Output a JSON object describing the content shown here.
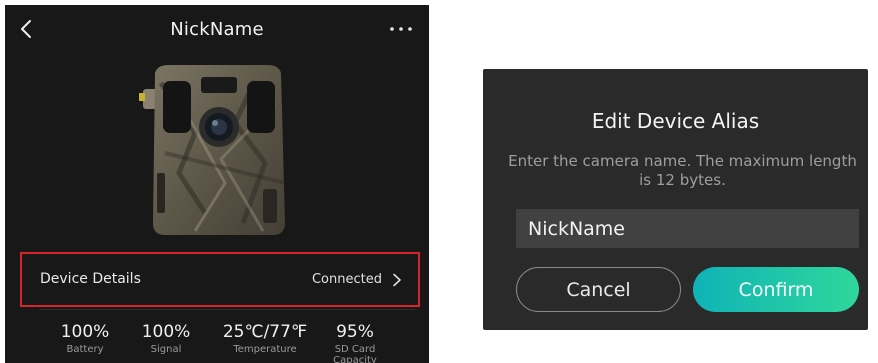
{
  "device_screen": {
    "title": "NickName",
    "details_label": "Device Details",
    "connection_status": "Connected",
    "stats": [
      {
        "value": "100%",
        "label": "Battery"
      },
      {
        "value": "100%",
        "label": "Signal"
      },
      {
        "value": "25℃/77℉",
        "label": "Temperature"
      },
      {
        "value": "95%",
        "label": "SD Card Capacity"
      }
    ],
    "icons": {
      "back": "chevron-left-icon",
      "more": "more-horizontal-icon",
      "details_chevron": "chevron-right-icon"
    },
    "highlight_color": "#d7262b"
  },
  "alias_dialog": {
    "title": "Edit Device Alias",
    "description": "Enter the camera name. The maximum length is 12 bytes.",
    "input_value": "NickName",
    "cancel_label": "Cancel",
    "confirm_label": "Confirm",
    "confirm_gradient": [
      "#0fb3b8",
      "#2fd79a"
    ]
  }
}
